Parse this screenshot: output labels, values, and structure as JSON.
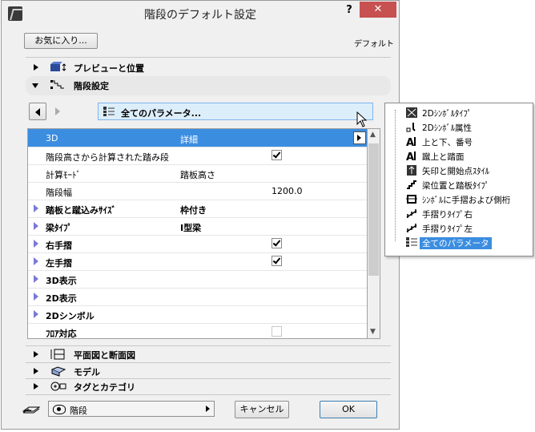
{
  "window": {
    "title": "階段のデフォルト設定",
    "help": "?",
    "close": "✕"
  },
  "favorites_button": "お気に入り...",
  "default_label": "デフォルト",
  "sections": {
    "preview": "プレビューと位置",
    "stair_settings": "階段設定",
    "plan_section": "平面図と断面図",
    "model": "モデル",
    "tags": "タグとカテゴリ"
  },
  "param_selector": {
    "label": "全てのパラメータ..."
  },
  "table_rows": [
    {
      "name": "3D",
      "value": "詳細",
      "type": "text",
      "selected": true
    },
    {
      "name": "階段高さから計算された踏み段",
      "type": "checkbox",
      "checked": true
    },
    {
      "name": "計算ﾓｰﾄﾞ",
      "value": "踏板高さ",
      "type": "text"
    },
    {
      "name": "階段幅",
      "number": "1200.0",
      "type": "number"
    },
    {
      "name": "踏板と蹴込みｻｲｽﾞ",
      "value": "枠付き",
      "type": "group"
    },
    {
      "name": "梁ﾀｲﾌﾟ",
      "value": "I型梁",
      "type": "group"
    },
    {
      "name": "右手摺",
      "type": "groupcb",
      "checked": true
    },
    {
      "name": "左手摺",
      "type": "groupcb",
      "checked": true
    },
    {
      "name": "3D表示",
      "type": "group"
    },
    {
      "name": "2D表示",
      "type": "group"
    },
    {
      "name": "2Dシンボル",
      "type": "group"
    },
    {
      "name": "ﾌﾛｱ対応",
      "type": "checkbox",
      "checked": false,
      "disabled": true
    }
  ],
  "popup_items": [
    {
      "label": "2Dｼﾝﾎﾞﾙﾀｲﾌﾟ",
      "icon": "symbol-type-icon"
    },
    {
      "label": "2Dｼﾝﾎﾞﾙ属性",
      "icon": "symbol-attr-icon"
    },
    {
      "label": "上と下、番号",
      "icon": "up-down-number-icon"
    },
    {
      "label": "蹴上と踏面",
      "icon": "riser-tread-icon"
    },
    {
      "label": "矢印と開始点ｽﾀｲﾙ",
      "icon": "arrow-start-icon"
    },
    {
      "label": "梁位置と踏板ﾀｲﾌﾟ",
      "icon": "beam-tread-icon"
    },
    {
      "label": "ｼﾝﾎﾞﾙに手摺および側桁",
      "icon": "symbol-rail-icon"
    },
    {
      "label": "手摺りﾀｲﾌﾟ右",
      "icon": "rail-right-icon"
    },
    {
      "label": "手摺りﾀｲﾌﾟ左",
      "icon": "rail-left-icon"
    },
    {
      "label": "全てのパラメータ",
      "icon": "all-params-icon",
      "selected": true
    }
  ],
  "layer": {
    "label": "階段"
  },
  "buttons": {
    "cancel": "キャンセル",
    "ok": "OK"
  },
  "colors": {
    "selection": "#3b8de0",
    "close": "#c75050",
    "dropdown_bg": "#ddeefb"
  }
}
